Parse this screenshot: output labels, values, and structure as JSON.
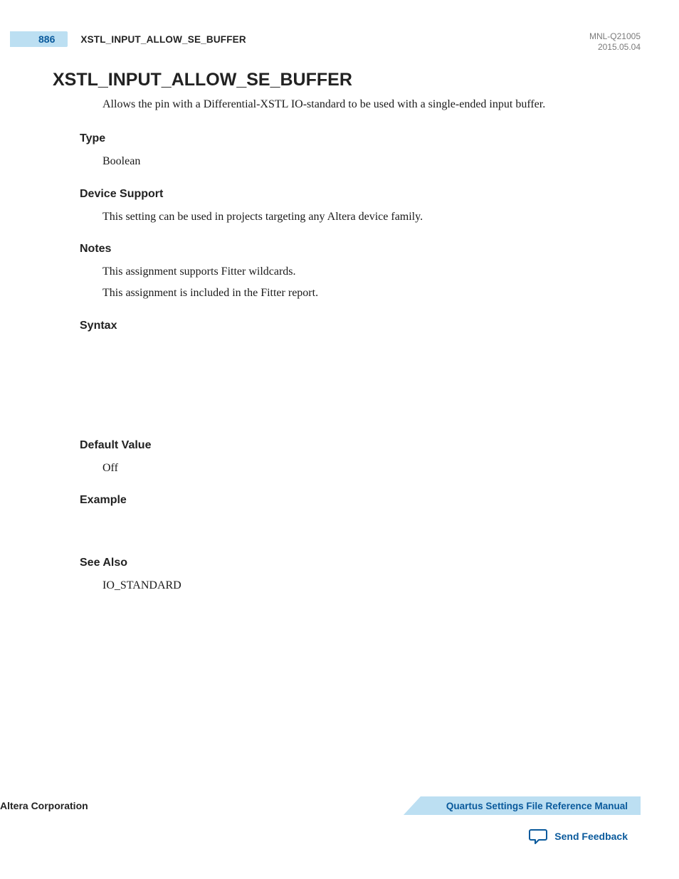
{
  "header": {
    "page_number": "886",
    "running_title": "XSTL_INPUT_ALLOW_SE_BUFFER",
    "doc_id": "MNL-Q21005",
    "date": "2015.05.04"
  },
  "title": "XSTL_INPUT_ALLOW_SE_BUFFER",
  "intro": "Allows the pin with a Differential-XSTL IO-standard to be used with a single-ended input buffer.",
  "sections": {
    "type": {
      "title": "Type",
      "body": "Boolean"
    },
    "device_support": {
      "title": "Device Support",
      "body": "This setting can be used in projects targeting any Altera device family."
    },
    "notes": {
      "title": "Notes",
      "lines": [
        "This assignment supports Fitter wildcards.",
        "This assignment is included in the Fitter report."
      ]
    },
    "syntax": {
      "title": "Syntax"
    },
    "default_value": {
      "title": "Default Value",
      "body": "Off"
    },
    "example": {
      "title": "Example"
    },
    "see_also": {
      "title": "See Also",
      "body": "IO_STANDARD"
    }
  },
  "footer": {
    "corporation": "Altera Corporation",
    "manual_link": "Quartus Settings File Reference Manual",
    "feedback": "Send Feedback"
  }
}
